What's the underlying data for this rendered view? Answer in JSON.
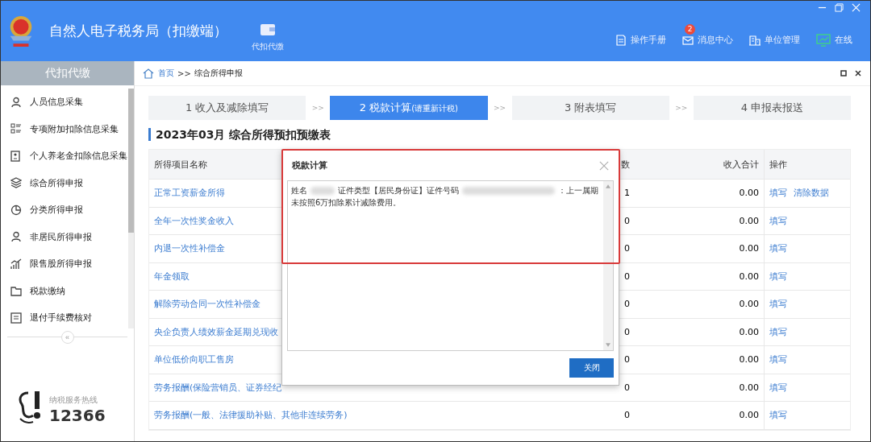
{
  "app": {
    "title": "自然人电子税务局（扣缴端）",
    "nav_item": "代扣代缴",
    "tools": [
      {
        "label": "操作手册"
      },
      {
        "label": "消息中心",
        "badge": "2"
      },
      {
        "label": "单位管理"
      },
      {
        "label": "在线"
      }
    ]
  },
  "sidebar": {
    "header": "代扣代缴",
    "items": [
      {
        "label": "人员信息采集"
      },
      {
        "label": "专项附加扣除信息采集"
      },
      {
        "label": "个人养老金扣除信息采集"
      },
      {
        "label": "综合所得申报"
      },
      {
        "label": "分类所得申报"
      },
      {
        "label": "非居民所得申报"
      },
      {
        "label": "限售股所得申报"
      },
      {
        "label": "税款缴纳"
      },
      {
        "label": "退付手续费核对"
      }
    ],
    "collapse": "«",
    "hotline_label": "纳税服务热线",
    "hotline": "12366"
  },
  "breadcrumb": {
    "home": "首页",
    "separator": ">>",
    "current": "综合所得申报"
  },
  "steps": [
    {
      "label": "1 收入及减除填写",
      "selected": false
    },
    {
      "prefix": ">>",
      "label": "2 税款计算",
      "note": "(请重新计税)",
      "selected": true
    },
    {
      "prefix": ">>",
      "label": "3 附表填写",
      "selected": false
    },
    {
      "prefix": ">>",
      "label": "4 申报表报送",
      "selected": false
    }
  ],
  "heading": "2023年03月  综合所得预扣预缴表",
  "table": {
    "columns": [
      "所得项目名称",
      "数",
      "收入合计",
      "操作"
    ],
    "rows": [
      {
        "name": "正常工资薪金所得",
        "count": "1",
        "amount": "0.00",
        "actions": [
          "填写",
          "清除数据"
        ]
      },
      {
        "name": "全年一次性奖金收入",
        "count": "0",
        "amount": "0.00",
        "actions": [
          "填写"
        ]
      },
      {
        "name": "内退一次性补偿金",
        "count": "0",
        "amount": "0.00",
        "actions": [
          "填写"
        ]
      },
      {
        "name": "年金领取",
        "count": "0",
        "amount": "0.00",
        "actions": [
          "填写"
        ]
      },
      {
        "name": "解除劳动合同一次性补偿金",
        "count": "0",
        "amount": "0.00",
        "actions": [
          "填写"
        ]
      },
      {
        "name": "央企负责人绩效薪金延期兑现收",
        "count": "0",
        "amount": "0.00",
        "actions": [
          "填写"
        ]
      },
      {
        "name": "单位低价向职工售房",
        "count": "0",
        "amount": "0.00",
        "actions": [
          "填写"
        ]
      },
      {
        "name": "劳务报酬(保险营销员、证券经纪",
        "count": "0",
        "amount": "0.00",
        "actions": [
          "填写"
        ]
      },
      {
        "name": "劳务报酬(一般、法律援助补贴、其他非连续劳务)",
        "count": "0",
        "amount": "0.00",
        "actions": [
          "填写"
        ]
      }
    ]
  },
  "dialog": {
    "title": "税款计算",
    "message": [
      "姓名",
      "证件类型【居民身份证】证件号码",
      "：上一属期未按照6万扣除累计减除费用。"
    ],
    "button": "关闭"
  }
}
